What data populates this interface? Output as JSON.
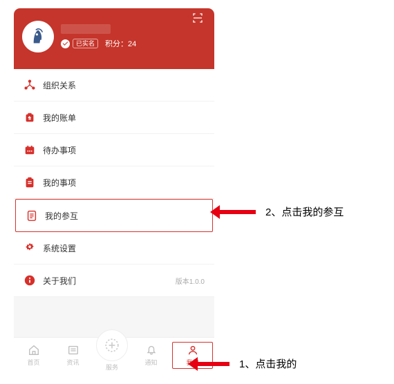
{
  "header": {
    "realname_label": "已实名",
    "points_label": "积分：",
    "points_value": "24"
  },
  "menu": {
    "items": [
      {
        "label": "组织关系",
        "side": "",
        "icon": "org"
      },
      {
        "label": "我的账单",
        "side": "",
        "icon": "bill"
      },
      {
        "label": "待办事项",
        "side": "",
        "icon": "todo"
      },
      {
        "label": "我的事项",
        "side": "",
        "icon": "myitem"
      },
      {
        "label": "我的参互",
        "side": "",
        "icon": "canhui",
        "highlight": true
      },
      {
        "label": "系统设置",
        "side": "",
        "icon": "gear"
      },
      {
        "label": "关于我们",
        "side": "版本1.0.0",
        "icon": "info"
      }
    ]
  },
  "nav": {
    "items": [
      {
        "label": "首页",
        "icon": "home"
      },
      {
        "label": "资讯",
        "icon": "news"
      },
      {
        "label": "服务",
        "icon": "plus"
      },
      {
        "label": "通知",
        "icon": "bell"
      },
      {
        "label": "我的",
        "icon": "mine",
        "active": true,
        "highlight": true
      }
    ]
  },
  "annotations": {
    "step1": "1、点击我的",
    "step2": "2、点击我的参互"
  }
}
